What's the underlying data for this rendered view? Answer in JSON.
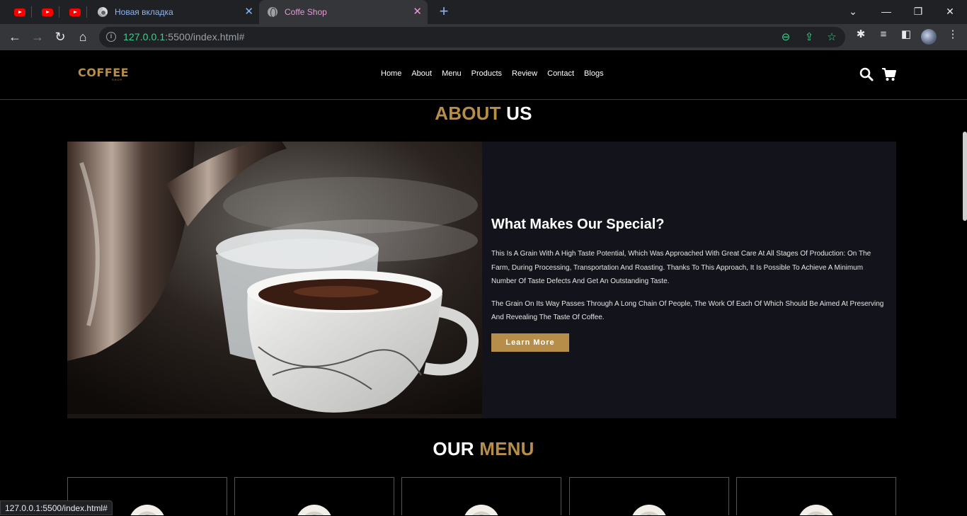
{
  "browser": {
    "pinned_tabs": [
      {
        "icon": "youtube-icon"
      },
      {
        "icon": "youtube-icon"
      },
      {
        "icon": "youtube-icon"
      }
    ],
    "tabs": [
      {
        "title": "Новая вкладка",
        "icon": "chrome-icon",
        "active": false
      },
      {
        "title": "Coffe Shop",
        "icon": "globe-icon",
        "active": true
      }
    ],
    "url_host": "127.0.0.1",
    "url_rest": ":5500/index.html#",
    "status_url": "127.0.0.1:5500/index.html#"
  },
  "site": {
    "logo": "COFFEE",
    "logo_sub": "SHOP",
    "nav": [
      "Home",
      "About",
      "Menu",
      "Products",
      "Review",
      "Contact",
      "Blogs"
    ],
    "about_title": {
      "part1": "ABOUT",
      "part2": "US"
    },
    "about": {
      "heading": "What Makes Our Special?",
      "p1": "This Is A Grain With A High Taste Potential, Which Was Approached With Great Care At All Stages Of Production: On The Farm, During Processing, Transportation And Roasting. Thanks To This Approach, It Is Possible To Achieve A Minimum Number Of Taste Defects And Get An Outstanding Taste.",
      "p2": "The Grain On Its Way Passes Through A Long Chain Of People, The Work Of Each Of Which Should Be Aimed At Preserving And Revealing The Taste Of Coffee.",
      "button": "Learn More"
    },
    "menu_title": {
      "part1": "OUR",
      "part2": "MENU"
    },
    "colors": {
      "accent": "#b68e4a",
      "panel": "#13131b",
      "background": "#000000"
    }
  }
}
